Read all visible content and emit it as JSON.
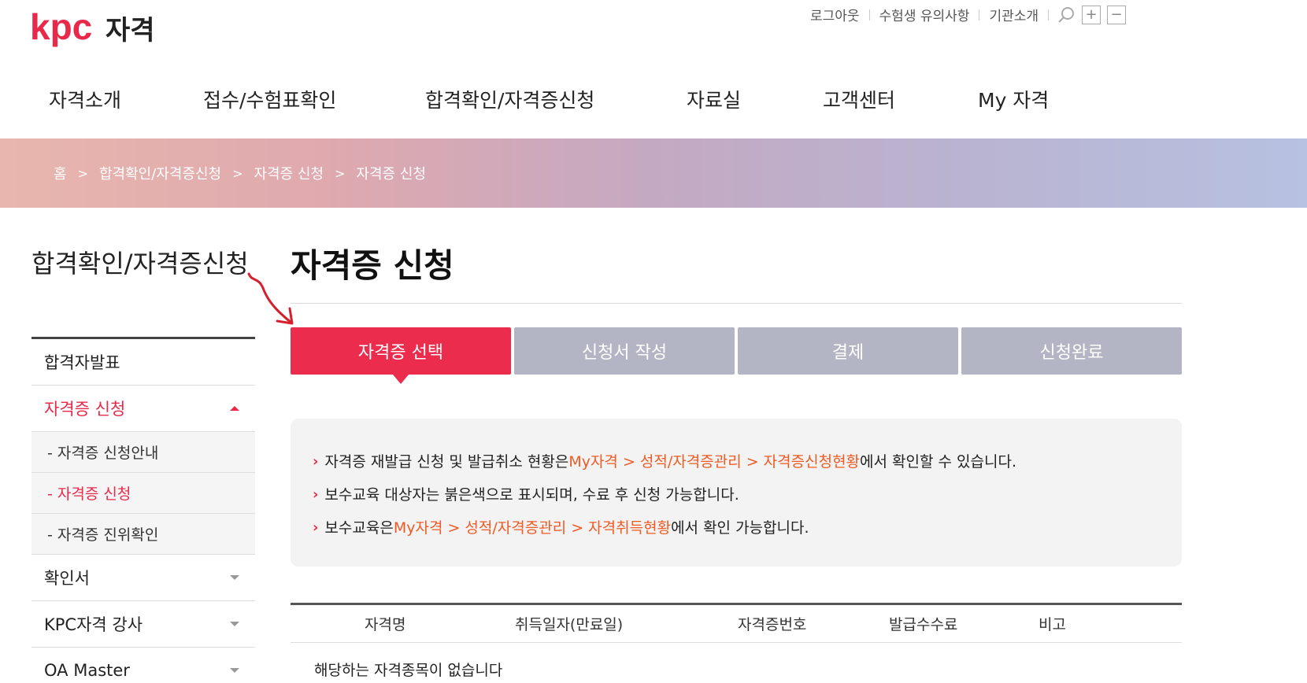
{
  "logo": {
    "brand": "kpc",
    "suffix": "자격"
  },
  "util": {
    "links": [
      "로그아웃",
      "수험생 유의사항",
      "기관소개"
    ],
    "plus": "+",
    "minus": "−"
  },
  "gnb": [
    "자격소개",
    "접수/수험표확인",
    "합격확인/자격증신청",
    "자료실",
    "고객센터",
    "My 자격"
  ],
  "breadcrumb": [
    "홈",
    "합격확인/자격증신청",
    "자격증 신청",
    "자격증 신청"
  ],
  "sidebar": {
    "title": "합격확인/자격증신청",
    "items": [
      {
        "label": "합격자발표"
      },
      {
        "label": "자격증 신청"
      },
      {
        "label": "확인서"
      },
      {
        "label": "KPC자격 강사"
      },
      {
        "label": "OA Master"
      }
    ],
    "sub_items": [
      {
        "label": "- 자격증 신청안내"
      },
      {
        "label": "- 자격증 신청"
      },
      {
        "label": "- 자격증 진위확인"
      }
    ]
  },
  "main": {
    "title": "자격증 신청",
    "steps": [
      "자격증 선택",
      "신청서 작성",
      "결제",
      "신청완료"
    ],
    "notice": [
      {
        "pre": "자격증 재발급 신청 및 발급취소 현황은 ",
        "hl": "My자격 > 성적/자격증관리 > 자격증신청현황",
        "post": "에서 확인할 수 있습니다."
      },
      {
        "pre": "보수교육 대상자는 붉은색으로 표시되며, 수료 후 신청 가능합니다.",
        "hl": "",
        "post": ""
      },
      {
        "pre": "보수교육은 ",
        "hl": "My자격 > 성적/자격증관리 > 자격취득현황",
        "post": "에서 확인 가능합니다."
      }
    ],
    "table": {
      "headers": [
        "자격명",
        "취득일자(만료일)",
        "자격증번호",
        "발급수수료",
        "비고"
      ],
      "empty": "해당하는 자격종목이 없습니다"
    }
  },
  "colors": {
    "accent": "#ec2c4c",
    "highlight": "#f05a24",
    "inactive_step": "#b3b5c4"
  }
}
